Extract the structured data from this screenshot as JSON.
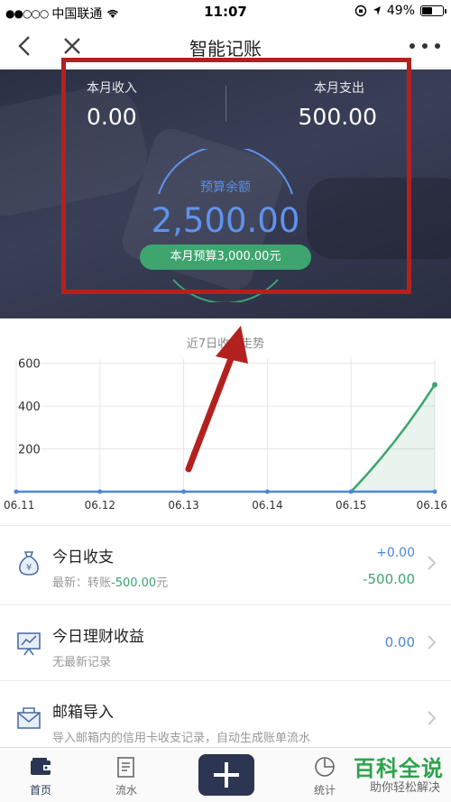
{
  "status_bar": {
    "carrier": "中国联通",
    "time": "11:07",
    "battery": "49%",
    "battery_level": 0.49
  },
  "nav": {
    "title": "智能记账"
  },
  "summary": {
    "income_label": "本月收入",
    "income_value": "0.00",
    "expense_label": "本月支出",
    "expense_value": "500.00",
    "budget_label": "预算余额",
    "budget_value": "2,500.00",
    "budget_pill": "本月预算3,000.00元"
  },
  "chart_title": "近7日收支走势",
  "chart_data": {
    "type": "line",
    "categories": [
      "06.11",
      "06.12",
      "06.13",
      "06.14",
      "06.15",
      "06.16"
    ],
    "yticks": [
      "600",
      "400",
      "200"
    ],
    "ylim": [
      0,
      620
    ],
    "series": [
      {
        "values": [
          0,
          0,
          0,
          0,
          0,
          500
        ],
        "color": "#3ea56f"
      },
      {
        "values": [
          0,
          0,
          0,
          0,
          0,
          0
        ],
        "color": "#4d86d8"
      }
    ]
  },
  "list": {
    "items": [
      {
        "name": "今日收支",
        "sub_prefix": "最新：转账",
        "sub_value": "-500.00",
        "sub_suffix": "元",
        "value_top": "+0.00",
        "value_bottom": "-500.00",
        "icon": "money-bag-icon"
      },
      {
        "name": "今日理财收益",
        "sub": "无最新记录",
        "value": "0.00",
        "icon": "presentation-chart-icon"
      },
      {
        "name": "邮箱导入",
        "sub": "导入邮箱内的信用卡收支记录，自动生成账单流水",
        "icon": "envelope-icon"
      }
    ]
  },
  "tabbar": {
    "home": "首页",
    "flow": "流水",
    "stats": "统计"
  },
  "watermark": {
    "title": "百科全说",
    "subtitle": "助你轻松解决"
  },
  "colors": {
    "accent_blue": "#5f93ec",
    "accent_green": "#3ea56f",
    "highlight_red": "#b3211f",
    "hero_bg": "#2b3044"
  }
}
